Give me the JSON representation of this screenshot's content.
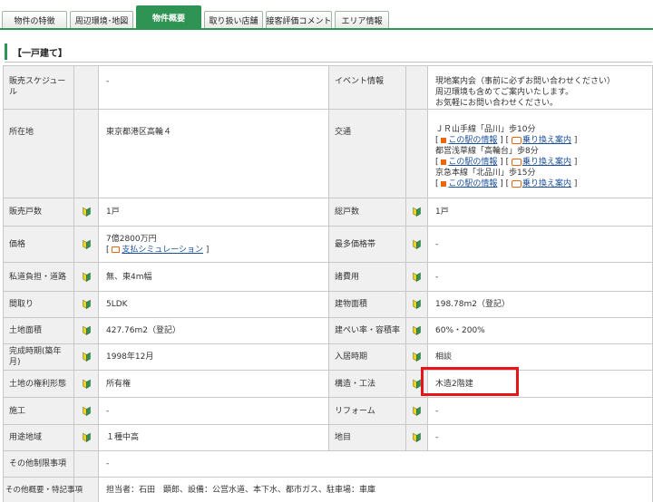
{
  "tabs": [
    {
      "label": "物件の特徴"
    },
    {
      "label": "周辺環境･地図"
    },
    {
      "label": "物件概要"
    },
    {
      "label": "取り扱い店舗"
    },
    {
      "label": "接客評価コメント"
    },
    {
      "label": "エリア情報"
    }
  ],
  "active_tab": "物件概要",
  "section": {
    "title": "【一戸建て】"
  },
  "rows": {
    "schedule": {
      "label": "販売スケジュール",
      "value": "-"
    },
    "event": {
      "label": "イベント情報",
      "lines": [
        "現地案内会（事前に必ずお問い合わせください）",
        "周辺環境も含めてご案内いたします。",
        "お気軽にお問い合わせください。"
      ]
    },
    "location": {
      "label": "所在地",
      "value": "東京都港区高輪４"
    },
    "access": {
      "label": "交通",
      "items": [
        {
          "line": "ＪＲ山手線「品川」歩10分",
          "station_info": "この駅の情報",
          "transfer": "乗り換え案内"
        },
        {
          "line": "都営浅草線「高輪台」歩8分",
          "station_info": "この駅の情報",
          "transfer": "乗り換え案内"
        },
        {
          "line": "京急本線「北品川」歩15分",
          "station_info": "この駅の情報",
          "transfer": "乗り換え案内"
        }
      ]
    },
    "units_for_sale": {
      "label": "販売戸数",
      "value": "1戸"
    },
    "total_units": {
      "label": "総戸数",
      "value": "1戸"
    },
    "price": {
      "label": "価格",
      "value": "7億2800万円",
      "sim_link": "支払シミュレーション"
    },
    "price_band": {
      "label": "最多価格帯",
      "value": "-"
    },
    "private_road": {
      "label": "私道負担・道路",
      "value": "無、東4m幅"
    },
    "misc_cost": {
      "label": "諸費用",
      "value": "-"
    },
    "floor_plan": {
      "label": "間取り",
      "value": "5LDK"
    },
    "building_area": {
      "label": "建物面積",
      "value": "198.78m2（登記）"
    },
    "land_area": {
      "label": "土地面積",
      "value": "427.76m2（登記）"
    },
    "coverage": {
      "label": "建ぺい率・容積率",
      "value": "60%・200%"
    },
    "completion": {
      "label": "完成時期(築年月)",
      "value": "1998年12月"
    },
    "move_in": {
      "label": "入居時期",
      "value": "相談"
    },
    "land_rights": {
      "label": "土地の権利形態",
      "value": "所有権"
    },
    "structure": {
      "label": "構造・工法",
      "value": "木造2階建"
    },
    "builder": {
      "label": "施工",
      "value": "-"
    },
    "reform": {
      "label": "リフォーム",
      "value": "-"
    },
    "zoning": {
      "label": "用途地域",
      "value": "１種中高"
    },
    "land_category": {
      "label": "地目",
      "value": "-"
    },
    "other_restrictions": {
      "label": "その他制限事項",
      "value": "-"
    },
    "other_notes": {
      "label": "その他概要・特記事項",
      "value": "担当者：石田　顕郎、設備：公営水道、本下水、都市ガス、駐車場：車庫"
    }
  },
  "colors": {
    "brand_green": "#2f9453",
    "highlight_red": "#e5151a",
    "link_blue": "#1a4f9c",
    "icon_orange": "#e8660f"
  },
  "icons": {
    "beginner_mark": "shoshinsha-leaf-icon"
  }
}
